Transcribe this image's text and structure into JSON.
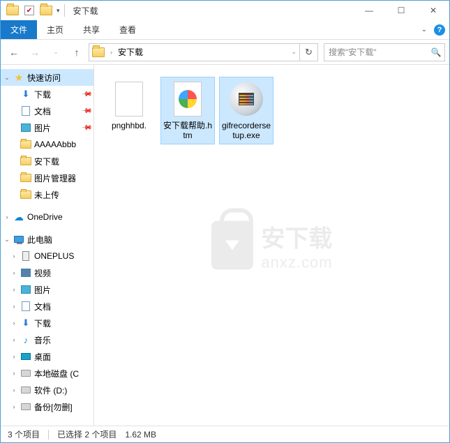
{
  "window": {
    "title": "安下载"
  },
  "ribbon": {
    "file": "文件",
    "home": "主页",
    "share": "共享",
    "view": "查看"
  },
  "address": {
    "segment": "安下载"
  },
  "search": {
    "placeholder": "搜索\"安下载\""
  },
  "sidebar": {
    "quick_access": "快速访问",
    "downloads": "下载",
    "documents": "文档",
    "pictures": "图片",
    "folder_a": "AAAAAbbb",
    "folder_anxz": "安下载",
    "folder_picmgr": "图片管理器",
    "folder_unuploaded": "未上传",
    "onedrive": "OneDrive",
    "this_pc": "此电脑",
    "oneplus": "ONEPLUS",
    "videos": "视频",
    "pictures2": "图片",
    "documents2": "文档",
    "downloads2": "下载",
    "music": "音乐",
    "desktop": "桌面",
    "drive_c": "本地磁盘 (C",
    "drive_d": "软件 (D:)",
    "drive_backup": "备份[勿删]"
  },
  "files": [
    {
      "name": "pnghhbd."
    },
    {
      "name": "安下载帮助.htm"
    },
    {
      "name": "gifrecordersetup.exe"
    }
  ],
  "watermark": {
    "line1": "安下载",
    "line2": "anxz.com"
  },
  "status": {
    "count": "3 个项目",
    "selection": "已选择 2 个项目",
    "size": "1.62 MB"
  }
}
